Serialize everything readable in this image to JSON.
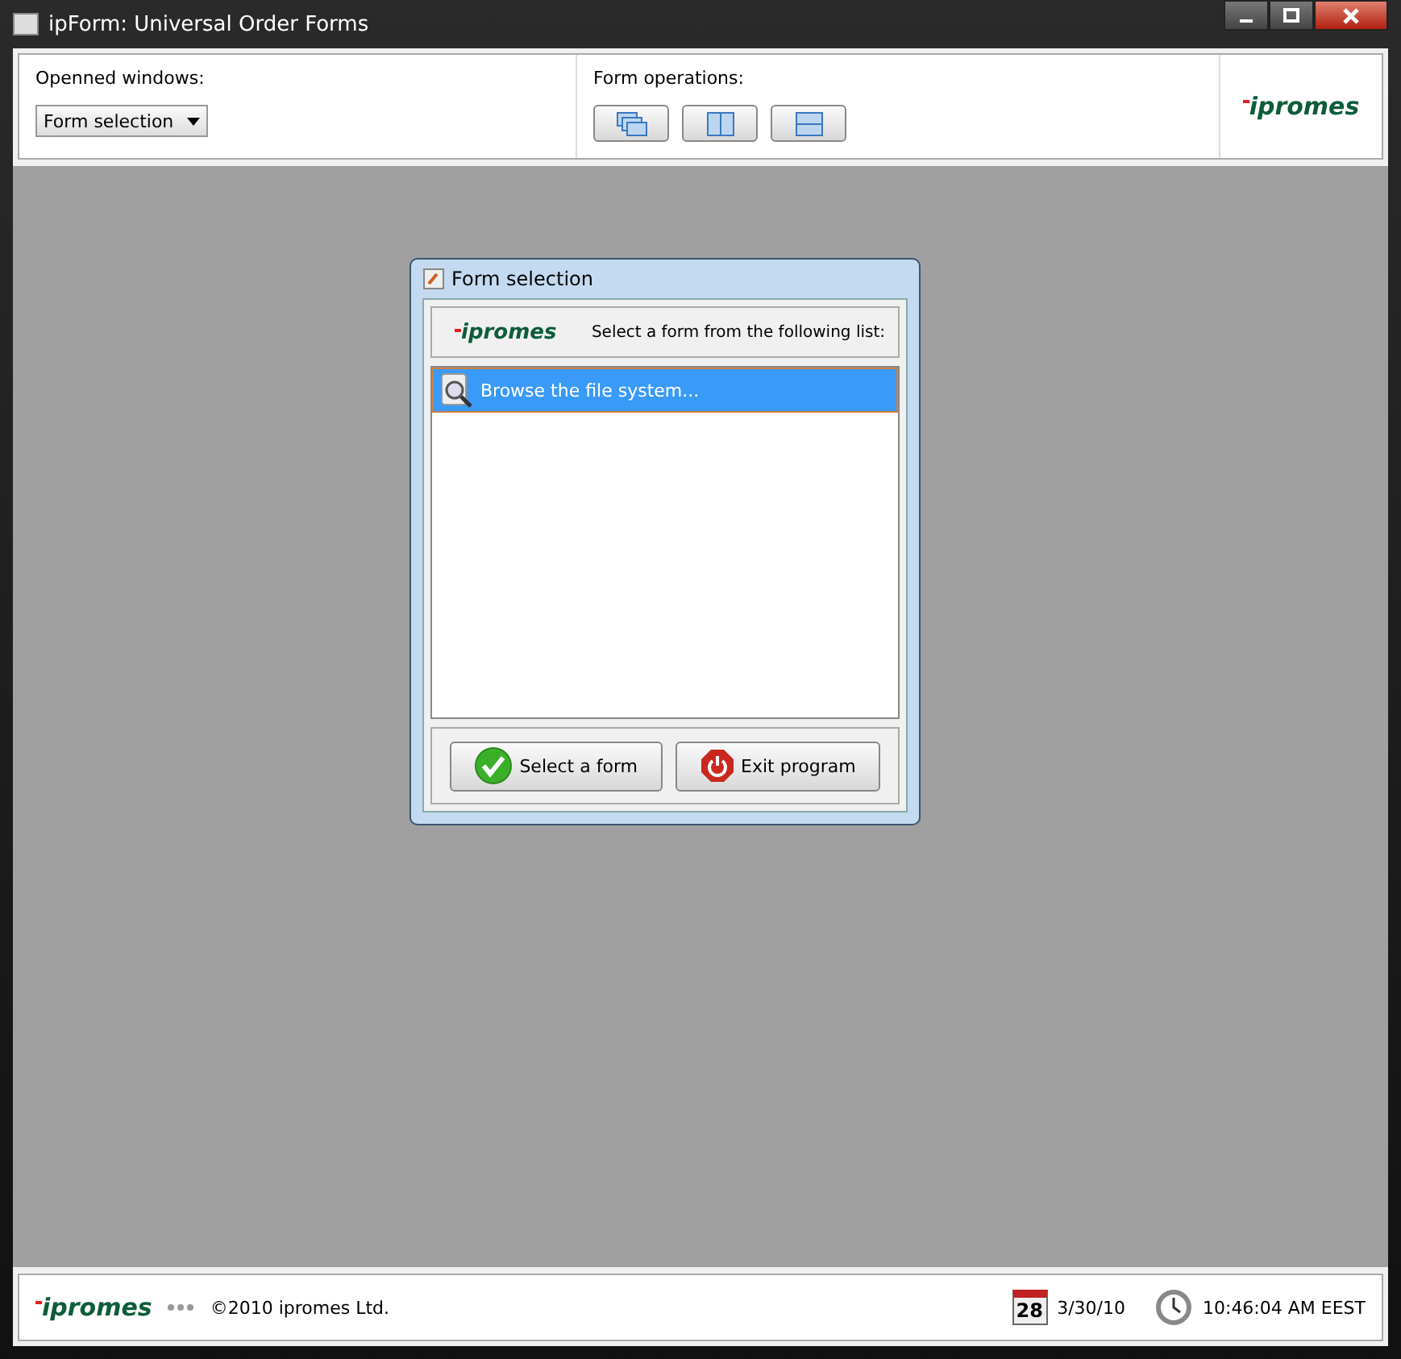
{
  "window": {
    "title": "ipForm: Universal Order Forms"
  },
  "toolbar": {
    "opened_windows": {
      "label": "Openned windows:",
      "dropdown": "Form selection"
    },
    "form_operations": {
      "label": "Form operations:",
      "buttons": [
        {
          "kind": "cascade"
        },
        {
          "kind": "vertical"
        },
        {
          "kind": "horizontal"
        }
      ]
    },
    "logo": "ipromes"
  },
  "dialog": {
    "title": "Form selection",
    "logo": "ipromes",
    "prompt": "Select a form from the following list:",
    "items": [
      {
        "label": "Browse the file system...",
        "selected": true
      }
    ],
    "buttons": [
      {
        "kind": "ok",
        "label": "Select a form"
      },
      {
        "kind": "exit",
        "label": "Exit program"
      }
    ]
  },
  "status_bar": {
    "logo": "ipromes",
    "copyright": "©2010 ipromes Ltd.",
    "calendar_day": "28",
    "date": "3/30/10",
    "time": "10:46:04 AM EEST"
  }
}
